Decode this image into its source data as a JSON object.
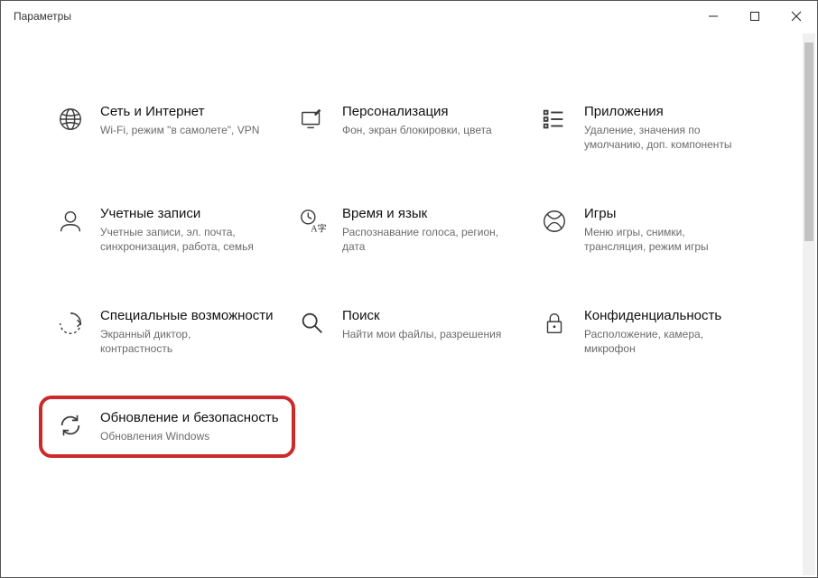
{
  "window": {
    "title": "Параметры"
  },
  "tiles": [
    {
      "title": "Сеть и Интернет",
      "desc": "Wi-Fi, режим \"в самолете\", VPN"
    },
    {
      "title": "Персонализация",
      "desc": "Фон, экран блокировки, цвета"
    },
    {
      "title": "Приложения",
      "desc": "Удаление, значения по умолчанию, доп. компоненты"
    },
    {
      "title": "Учетные записи",
      "desc": "Учетные записи, эл. почта, синхронизация, работа, семья"
    },
    {
      "title": "Время и язык",
      "desc": "Распознавание голоса, регион, дата"
    },
    {
      "title": "Игры",
      "desc": "Меню игры, снимки, трансляция, режим игры"
    },
    {
      "title": "Специальные возможности",
      "desc": "Экранный диктор, контрастность"
    },
    {
      "title": "Поиск",
      "desc": "Найти мои файлы, разрешения"
    },
    {
      "title": "Конфиденциальность",
      "desc": "Расположение, камера, микрофон"
    },
    {
      "title": "Обновление и безопасность",
      "desc": "Обновления Windows"
    }
  ]
}
